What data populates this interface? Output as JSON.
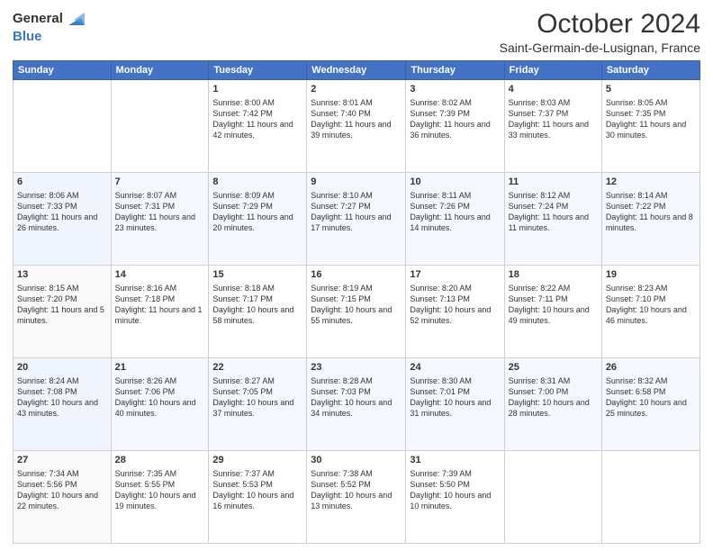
{
  "logo": {
    "general": "General",
    "blue": "Blue"
  },
  "title": "October 2024",
  "subtitle": "Saint-Germain-de-Lusignan, France",
  "calendar": {
    "headers": [
      "Sunday",
      "Monday",
      "Tuesday",
      "Wednesday",
      "Thursday",
      "Friday",
      "Saturday"
    ],
    "weeks": [
      [
        {
          "day": "",
          "sunrise": "",
          "sunset": "",
          "daylight": ""
        },
        {
          "day": "",
          "sunrise": "",
          "sunset": "",
          "daylight": ""
        },
        {
          "day": "1",
          "sunrise": "Sunrise: 8:00 AM",
          "sunset": "Sunset: 7:42 PM",
          "daylight": "Daylight: 11 hours and 42 minutes."
        },
        {
          "day": "2",
          "sunrise": "Sunrise: 8:01 AM",
          "sunset": "Sunset: 7:40 PM",
          "daylight": "Daylight: 11 hours and 39 minutes."
        },
        {
          "day": "3",
          "sunrise": "Sunrise: 8:02 AM",
          "sunset": "Sunset: 7:39 PM",
          "daylight": "Daylight: 11 hours and 36 minutes."
        },
        {
          "day": "4",
          "sunrise": "Sunrise: 8:03 AM",
          "sunset": "Sunset: 7:37 PM",
          "daylight": "Daylight: 11 hours and 33 minutes."
        },
        {
          "day": "5",
          "sunrise": "Sunrise: 8:05 AM",
          "sunset": "Sunset: 7:35 PM",
          "daylight": "Daylight: 11 hours and 30 minutes."
        }
      ],
      [
        {
          "day": "6",
          "sunrise": "Sunrise: 8:06 AM",
          "sunset": "Sunset: 7:33 PM",
          "daylight": "Daylight: 11 hours and 26 minutes."
        },
        {
          "day": "7",
          "sunrise": "Sunrise: 8:07 AM",
          "sunset": "Sunset: 7:31 PM",
          "daylight": "Daylight: 11 hours and 23 minutes."
        },
        {
          "day": "8",
          "sunrise": "Sunrise: 8:09 AM",
          "sunset": "Sunset: 7:29 PM",
          "daylight": "Daylight: 11 hours and 20 minutes."
        },
        {
          "day": "9",
          "sunrise": "Sunrise: 8:10 AM",
          "sunset": "Sunset: 7:27 PM",
          "daylight": "Daylight: 11 hours and 17 minutes."
        },
        {
          "day": "10",
          "sunrise": "Sunrise: 8:11 AM",
          "sunset": "Sunset: 7:26 PM",
          "daylight": "Daylight: 11 hours and 14 minutes."
        },
        {
          "day": "11",
          "sunrise": "Sunrise: 8:12 AM",
          "sunset": "Sunset: 7:24 PM",
          "daylight": "Daylight: 11 hours and 11 minutes."
        },
        {
          "day": "12",
          "sunrise": "Sunrise: 8:14 AM",
          "sunset": "Sunset: 7:22 PM",
          "daylight": "Daylight: 11 hours and 8 minutes."
        }
      ],
      [
        {
          "day": "13",
          "sunrise": "Sunrise: 8:15 AM",
          "sunset": "Sunset: 7:20 PM",
          "daylight": "Daylight: 11 hours and 5 minutes."
        },
        {
          "day": "14",
          "sunrise": "Sunrise: 8:16 AM",
          "sunset": "Sunset: 7:18 PM",
          "daylight": "Daylight: 11 hours and 1 minute."
        },
        {
          "day": "15",
          "sunrise": "Sunrise: 8:18 AM",
          "sunset": "Sunset: 7:17 PM",
          "daylight": "Daylight: 10 hours and 58 minutes."
        },
        {
          "day": "16",
          "sunrise": "Sunrise: 8:19 AM",
          "sunset": "Sunset: 7:15 PM",
          "daylight": "Daylight: 10 hours and 55 minutes."
        },
        {
          "day": "17",
          "sunrise": "Sunrise: 8:20 AM",
          "sunset": "Sunset: 7:13 PM",
          "daylight": "Daylight: 10 hours and 52 minutes."
        },
        {
          "day": "18",
          "sunrise": "Sunrise: 8:22 AM",
          "sunset": "Sunset: 7:11 PM",
          "daylight": "Daylight: 10 hours and 49 minutes."
        },
        {
          "day": "19",
          "sunrise": "Sunrise: 8:23 AM",
          "sunset": "Sunset: 7:10 PM",
          "daylight": "Daylight: 10 hours and 46 minutes."
        }
      ],
      [
        {
          "day": "20",
          "sunrise": "Sunrise: 8:24 AM",
          "sunset": "Sunset: 7:08 PM",
          "daylight": "Daylight: 10 hours and 43 minutes."
        },
        {
          "day": "21",
          "sunrise": "Sunrise: 8:26 AM",
          "sunset": "Sunset: 7:06 PM",
          "daylight": "Daylight: 10 hours and 40 minutes."
        },
        {
          "day": "22",
          "sunrise": "Sunrise: 8:27 AM",
          "sunset": "Sunset: 7:05 PM",
          "daylight": "Daylight: 10 hours and 37 minutes."
        },
        {
          "day": "23",
          "sunrise": "Sunrise: 8:28 AM",
          "sunset": "Sunset: 7:03 PM",
          "daylight": "Daylight: 10 hours and 34 minutes."
        },
        {
          "day": "24",
          "sunrise": "Sunrise: 8:30 AM",
          "sunset": "Sunset: 7:01 PM",
          "daylight": "Daylight: 10 hours and 31 minutes."
        },
        {
          "day": "25",
          "sunrise": "Sunrise: 8:31 AM",
          "sunset": "Sunset: 7:00 PM",
          "daylight": "Daylight: 10 hours and 28 minutes."
        },
        {
          "day": "26",
          "sunrise": "Sunrise: 8:32 AM",
          "sunset": "Sunset: 6:58 PM",
          "daylight": "Daylight: 10 hours and 25 minutes."
        }
      ],
      [
        {
          "day": "27",
          "sunrise": "Sunrise: 7:34 AM",
          "sunset": "Sunset: 5:56 PM",
          "daylight": "Daylight: 10 hours and 22 minutes."
        },
        {
          "day": "28",
          "sunrise": "Sunrise: 7:35 AM",
          "sunset": "Sunset: 5:55 PM",
          "daylight": "Daylight: 10 hours and 19 minutes."
        },
        {
          "day": "29",
          "sunrise": "Sunrise: 7:37 AM",
          "sunset": "Sunset: 5:53 PM",
          "daylight": "Daylight: 10 hours and 16 minutes."
        },
        {
          "day": "30",
          "sunrise": "Sunrise: 7:38 AM",
          "sunset": "Sunset: 5:52 PM",
          "daylight": "Daylight: 10 hours and 13 minutes."
        },
        {
          "day": "31",
          "sunrise": "Sunrise: 7:39 AM",
          "sunset": "Sunset: 5:50 PM",
          "daylight": "Daylight: 10 hours and 10 minutes."
        },
        {
          "day": "",
          "sunrise": "",
          "sunset": "",
          "daylight": ""
        },
        {
          "day": "",
          "sunrise": "",
          "sunset": "",
          "daylight": ""
        }
      ]
    ]
  }
}
